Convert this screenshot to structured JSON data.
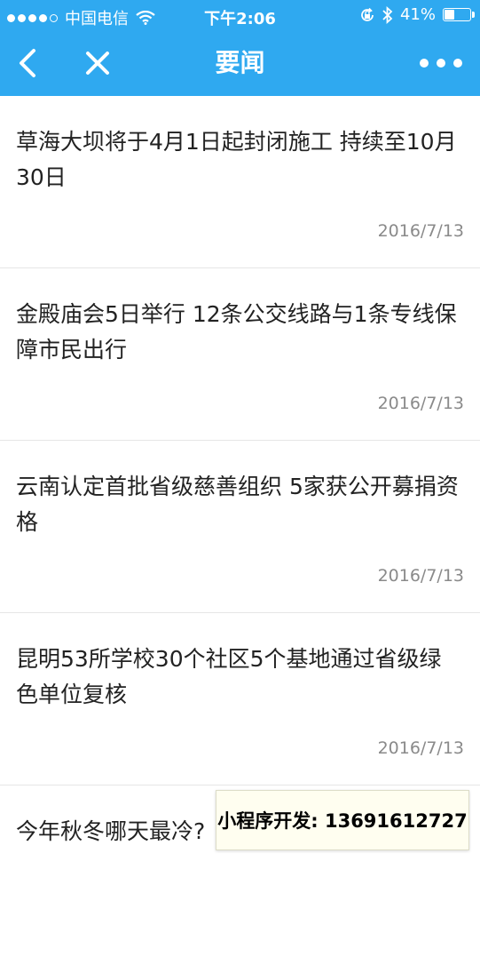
{
  "status_bar": {
    "carrier": "中国电信",
    "time": "下午2:06",
    "battery_percent": "41%",
    "battery_level": 0.41,
    "icons": [
      "signal-dots-icon",
      "wifi-icon",
      "lock-rotation-icon",
      "bluetooth-icon",
      "battery-icon"
    ]
  },
  "nav": {
    "title": "要闻",
    "back_icon": "chevron-left-icon",
    "close_icon": "close-icon",
    "more_icon": "more-dots-icon"
  },
  "news": [
    {
      "title": "草海大坝将于4月1日起封闭施工 持续至10月30日",
      "date": "2016/7/13"
    },
    {
      "title": "金殿庙会5日举行 12条公交线路与1条专线保障市民出行",
      "date": "2016/7/13"
    },
    {
      "title": "云南认定首批省级慈善组织 5家获公开募捐资格",
      "date": "2016/7/13"
    },
    {
      "title": "昆明53所学校30个社区5个基地通过省级绿色单位复核",
      "date": "2016/7/13"
    },
    {
      "title": "今年秋冬哪天最冷?",
      "date": ""
    }
  ],
  "promo": {
    "text": "小程序开发: 13691612727"
  },
  "colors": {
    "header": "#2fa9f0",
    "title_text": "#222222",
    "date_text": "#8a8a8a"
  }
}
